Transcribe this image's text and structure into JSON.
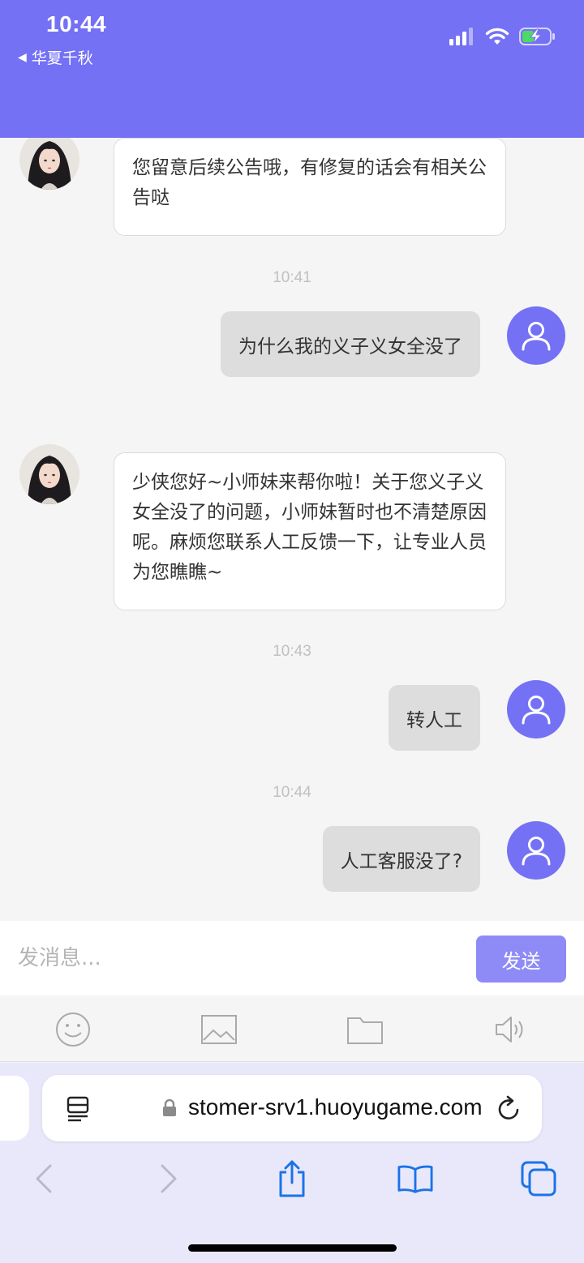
{
  "status_bar": {
    "time": "10:44",
    "back_app": "华夏千秋",
    "back_arrow": "◀"
  },
  "messages": [
    {
      "side": "left",
      "text": "您留意后续公告哦，有修复的话会有相关公告哒"
    },
    {
      "timestamp": "10:41"
    },
    {
      "side": "right",
      "text": "为什么我的义子义女全没了"
    },
    {
      "side": "left",
      "text": "少侠您好~小师妹来帮你啦！关于您义子义女全没了的问题，小师妹暂时也不清楚原因呢。麻烦您联系人工反馈一下，让专业人员为您瞧瞧~"
    },
    {
      "timestamp": "10:43"
    },
    {
      "side": "right",
      "text": "转人工"
    },
    {
      "timestamp": "10:44"
    },
    {
      "side": "right",
      "text": "人工客服没了?"
    }
  ],
  "input": {
    "placeholder": "发消息...",
    "value": "",
    "send_label": "发送"
  },
  "toolbar": {
    "icons": [
      "emoji-icon",
      "image-icon",
      "folder-icon",
      "voice-icon"
    ]
  },
  "browser": {
    "url": "stomer-srv1.huoyugame.com"
  },
  "colors": {
    "accent": "#7471f5",
    "send_button": "#8e8bf7",
    "user_bubble": "#dddddd",
    "bot_bubble": "#ffffff",
    "ios_blue": "#1a73e8"
  }
}
